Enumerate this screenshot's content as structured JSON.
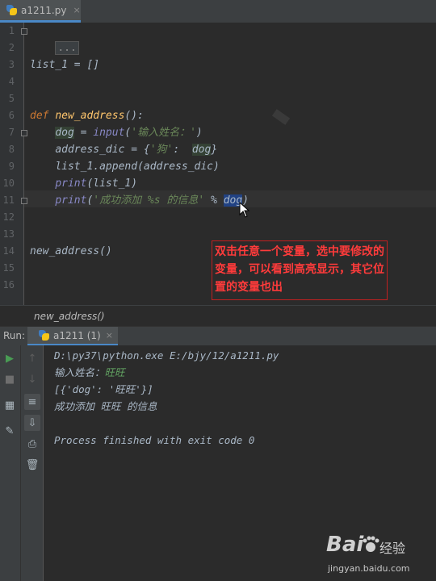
{
  "tab": {
    "filename": "a1211.py",
    "close": "×"
  },
  "editor": {
    "lines": [
      {
        "n": "1",
        "html_id": "l1"
      },
      {
        "n": "2"
      },
      {
        "n": "3"
      },
      {
        "n": "4"
      },
      {
        "n": "5"
      },
      {
        "n": "6"
      },
      {
        "n": "7"
      },
      {
        "n": "8"
      },
      {
        "n": "9"
      },
      {
        "n": "10"
      },
      {
        "n": "11"
      },
      {
        "n": "12"
      },
      {
        "n": "13"
      },
      {
        "n": "14"
      },
      {
        "n": "15"
      },
      {
        "n": "16"
      }
    ],
    "collapsed_import": "...",
    "line4": {
      "name": "list_1",
      "op": " = ",
      "value": "[]"
    },
    "line7": {
      "kw": "def",
      "name": "new_address",
      "rest": "():"
    },
    "line8": {
      "var": "dog",
      "op": " = ",
      "fn": "input",
      "open": "(",
      "str": "'输入姓名：'",
      "close": ")"
    },
    "line9": {
      "pre": "address_dic = {",
      "str": "'狗'",
      "mid": ":  ",
      "var": "dog",
      "post": "}"
    },
    "line10": {
      "pre": "list_1.",
      "fn": "append",
      "post": "(address_dic)"
    },
    "line11": {
      "fn": "print",
      "post": "(list_1)"
    },
    "line12": {
      "fn": "print",
      "open": "(",
      "str": "'成功添加 %s 的信息'",
      "mid": " % ",
      "sel": "dog",
      "post": ")"
    },
    "line15": {
      "call": "new_address()"
    }
  },
  "annotation": {
    "text": "双击任意一个变量，选中要修改的变量，可以看到高亮显示，其它位置的变量也出"
  },
  "breadcrumb": {
    "text": "new_address()"
  },
  "run": {
    "label": "Run:",
    "tab": "a1211 (1)",
    "close": "×",
    "console": {
      "cmd": "D:\\py37\\python.exe E:/bjy/12/a1211.py",
      "prompt": "输入姓名：",
      "input_value": "旺旺",
      "list_out": "[{'dog': '旺旺'}]",
      "msg": "成功添加 旺旺 的信息",
      "finished": "Process finished with exit code 0"
    }
  },
  "watermark": {
    "logo": "Bai",
    "brand": "经验",
    "url": "jingyan.baidu.com"
  },
  "colors": {
    "keyword": "#cc7832",
    "function": "#ffc66d",
    "string": "#6a8759",
    "selection": "#214283",
    "annotation": "#ff3b3b"
  }
}
